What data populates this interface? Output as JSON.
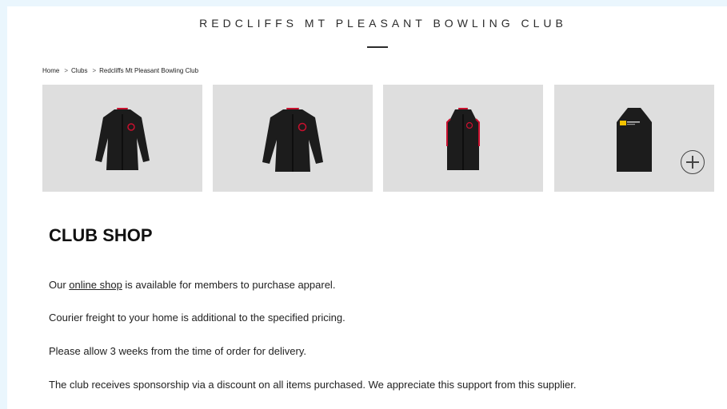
{
  "header": {
    "title": "REDCLIFFS MT PLEASANT BOWLING CLUB"
  },
  "breadcrumb": {
    "items": [
      "Home",
      "Clubs",
      "Redcliffs Mt Pleasant Bowling Club"
    ],
    "separator": ">"
  },
  "section": {
    "heading": "CLUB SHOP",
    "p1_before": "Our ",
    "p1_link": "online shop",
    "p1_after": " is available for members to purchase apparel.",
    "p2": "Courier freight to your home is additional to the specified pricing.",
    "p3": "Please allow 3 weeks from the time of order for delivery.",
    "p4": "The club receives sponsorship via a discount on all items purchased. We appreciate this support from this supplier."
  },
  "colors": {
    "page_bg": "#eaf6fd",
    "thumb_bg": "#dedede",
    "accent_red": "#c8102e",
    "garment": "#1c1c1c"
  },
  "icons": {
    "zoom": "plus-circle-icon"
  }
}
